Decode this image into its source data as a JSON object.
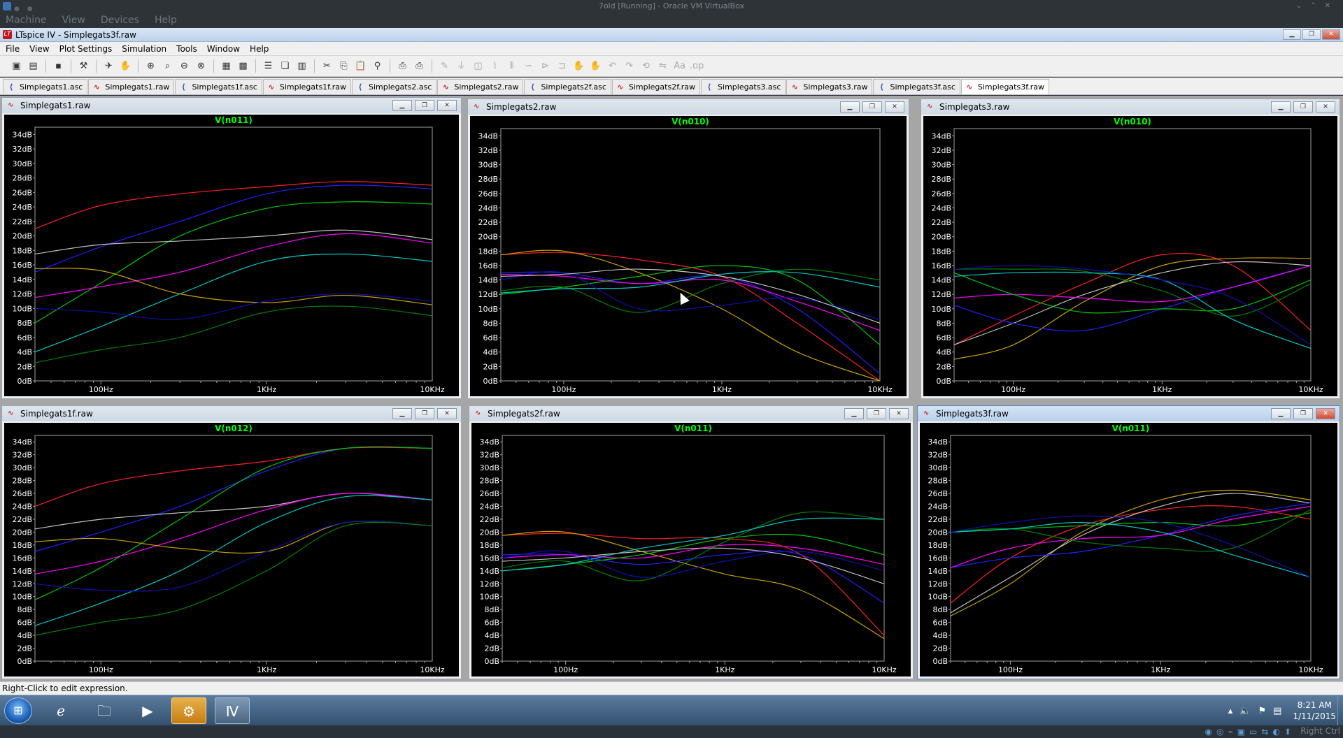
{
  "vbox": {
    "title": "7old [Running] - Oracle VM VirtualBox",
    "menu": [
      "Machine",
      "View",
      "Devices",
      "Help"
    ],
    "host_key": "Right Ctrl"
  },
  "app": {
    "title": "LTspice IV - Simplegats3f.raw",
    "menu": [
      "File",
      "View",
      "Plot Settings",
      "Simulation",
      "Tools",
      "Window",
      "Help"
    ],
    "status": "Right-Click to edit expression."
  },
  "tabs": [
    {
      "label": "Simplegats1.asc",
      "kind": "schematic"
    },
    {
      "label": "Simplegats1.raw",
      "kind": "waveform"
    },
    {
      "label": "Simplegats1f.asc",
      "kind": "schematic"
    },
    {
      "label": "Simplegats1f.raw",
      "kind": "waveform"
    },
    {
      "label": "Simplegats2.asc",
      "kind": "schematic"
    },
    {
      "label": "Simplegats2.raw",
      "kind": "waveform"
    },
    {
      "label": "Simplegats2f.asc",
      "kind": "schematic"
    },
    {
      "label": "Simplegats2f.raw",
      "kind": "waveform"
    },
    {
      "label": "Simplegats3.asc",
      "kind": "schematic"
    },
    {
      "label": "Simplegats3.raw",
      "kind": "waveform"
    },
    {
      "label": "Simplegats3f.asc",
      "kind": "schematic"
    },
    {
      "label": "Simplegats3f.raw",
      "kind": "waveform",
      "active": true
    }
  ],
  "colors": {
    "plot_bg": "#000000",
    "axis": "#a0a0a0",
    "text": "#ffffff",
    "trace_title": "#00ff00",
    "series": [
      "#ff2020",
      "#2020ff",
      "#00c800",
      "#ff00ff",
      "#00c8c8",
      "#c8a000",
      "#c0c0c0",
      "#1010b0",
      "#008000"
    ]
  },
  "chart_data": [
    {
      "window_title": "Simplegats1.raw",
      "type": "line",
      "title": "V(n011)",
      "x_scale": "log",
      "xlim": [
        40,
        10000
      ],
      "ylim": [
        0,
        35
      ],
      "yticks": [
        "0dB",
        "2dB",
        "4dB",
        "6dB",
        "8dB",
        "10dB",
        "12dB",
        "14dB",
        "16dB",
        "18dB",
        "20dB",
        "22dB",
        "24dB",
        "26dB",
        "28dB",
        "30dB",
        "32dB",
        "34dB"
      ],
      "xticks": [
        {
          "v": 100,
          "label": "100Hz"
        },
        {
          "v": 1000,
          "label": "1KHz"
        },
        {
          "v": 10000,
          "label": "10KHz"
        }
      ],
      "x": [
        40,
        100,
        300,
        1000,
        3000,
        10000
      ],
      "series": [
        {
          "color": "#ff2020",
          "values": [
            21,
            24.2,
            25.8,
            26.8,
            27.5,
            27
          ]
        },
        {
          "color": "#2020ff",
          "values": [
            15,
            18.5,
            22,
            25.8,
            27,
            26.5
          ]
        },
        {
          "color": "#00c800",
          "values": [
            8,
            13.5,
            20,
            23.8,
            24.7,
            24.4
          ]
        },
        {
          "color": "#c0c0c0",
          "values": [
            17.5,
            18.8,
            19.3,
            20,
            20.8,
            19.5
          ]
        },
        {
          "color": "#ff00ff",
          "values": [
            11.5,
            13,
            15,
            18.5,
            20.3,
            19
          ]
        },
        {
          "color": "#00c8c8",
          "values": [
            4,
            7.5,
            12,
            16.5,
            17.5,
            16.5
          ]
        },
        {
          "color": "#c8a000",
          "values": [
            15.5,
            15.2,
            12,
            10.8,
            11.8,
            10.5
          ]
        },
        {
          "color": "#1010b0",
          "values": [
            10,
            9.5,
            8.5,
            11,
            12,
            11
          ]
        },
        {
          "color": "#008000",
          "values": [
            2.5,
            4.3,
            6,
            9.5,
            10.3,
            9
          ]
        }
      ]
    },
    {
      "window_title": "Simplegats2.raw",
      "type": "line",
      "title": "V(n010)",
      "x_scale": "log",
      "xlim": [
        40,
        10000
      ],
      "ylim": [
        0,
        35
      ],
      "yticks": [
        "0dB",
        "2dB",
        "4dB",
        "6dB",
        "8dB",
        "10dB",
        "12dB",
        "14dB",
        "16dB",
        "18dB",
        "20dB",
        "22dB",
        "24dB",
        "26dB",
        "28dB",
        "30dB",
        "32dB",
        "34dB"
      ],
      "xticks": [
        {
          "v": 100,
          "label": "100Hz"
        },
        {
          "v": 1000,
          "label": "1KHz"
        },
        {
          "v": 10000,
          "label": "10KHz"
        }
      ],
      "x": [
        40,
        100,
        300,
        1000,
        3000,
        10000
      ],
      "series": [
        {
          "color": "#ff2020",
          "values": [
            17.5,
            17.8,
            16.8,
            14.5,
            8,
            0
          ]
        },
        {
          "color": "#c8a000",
          "values": [
            17.5,
            18,
            15,
            10,
            4,
            0
          ]
        },
        {
          "color": "#2020ff",
          "values": [
            15,
            15,
            13.5,
            14.5,
            10,
            1
          ]
        },
        {
          "color": "#ff00ff",
          "values": [
            14.8,
            14.5,
            13.5,
            14,
            11,
            7
          ]
        },
        {
          "color": "#00c800",
          "values": [
            12,
            13,
            14.5,
            16,
            14,
            5
          ]
        },
        {
          "color": "#008000",
          "values": [
            12.5,
            13,
            9.5,
            13.5,
            15.5,
            14
          ]
        },
        {
          "color": "#00c8c8",
          "values": [
            12.2,
            12.8,
            13,
            14.8,
            15,
            13
          ]
        },
        {
          "color": "#1010b0",
          "values": [
            14,
            15,
            10,
            10.5,
            11.5,
            8.5
          ]
        },
        {
          "color": "#c0c0c0",
          "values": [
            14.5,
            14.8,
            15.5,
            14.5,
            12,
            8
          ]
        }
      ]
    },
    {
      "window_title": "Simplegats3.raw",
      "type": "line",
      "title": "V(n010)",
      "x_scale": "log",
      "xlim": [
        40,
        10000
      ],
      "ylim": [
        0,
        35
      ],
      "yticks": [
        "0dB",
        "2dB",
        "4dB",
        "6dB",
        "8dB",
        "10dB",
        "12dB",
        "14dB",
        "16dB",
        "18dB",
        "20dB",
        "22dB",
        "24dB",
        "26dB",
        "28dB",
        "30dB",
        "32dB",
        "34dB"
      ],
      "xticks": [
        {
          "v": 100,
          "label": "100Hz"
        },
        {
          "v": 1000,
          "label": "1KHz"
        },
        {
          "v": 10000,
          "label": "10KHz"
        }
      ],
      "x": [
        40,
        100,
        300,
        1000,
        3000,
        10000
      ],
      "series": [
        {
          "color": "#ff2020",
          "values": [
            5,
            9,
            13.5,
            17.5,
            16,
            7
          ]
        },
        {
          "color": "#c8a000",
          "values": [
            3,
            5,
            11,
            16,
            17,
            17
          ]
        },
        {
          "color": "#c0c0c0",
          "values": [
            5,
            8,
            12,
            15,
            16.5,
            16
          ]
        },
        {
          "color": "#2020ff",
          "values": [
            10.5,
            8,
            7,
            10,
            13,
            16
          ]
        },
        {
          "color": "#ff00ff",
          "values": [
            11.5,
            12,
            11.5,
            11,
            13,
            16
          ]
        },
        {
          "color": "#00c800",
          "values": [
            15,
            12,
            9.5,
            10,
            10,
            14
          ]
        },
        {
          "color": "#008000",
          "values": [
            15.5,
            15.5,
            15.2,
            12.5,
            9,
            13.5
          ]
        },
        {
          "color": "#00c8c8",
          "values": [
            14.5,
            15,
            15,
            14,
            8.5,
            4.5
          ]
        },
        {
          "color": "#1010b0",
          "values": [
            15.5,
            16,
            15.5,
            14,
            11.5,
            5
          ]
        }
      ]
    },
    {
      "window_title": "Simplegats1f.raw",
      "type": "line",
      "title": "V(n012)",
      "x_scale": "log",
      "xlim": [
        40,
        10000
      ],
      "ylim": [
        0,
        35
      ],
      "yticks": [
        "0dB",
        "2dB",
        "4dB",
        "6dB",
        "8dB",
        "10dB",
        "12dB",
        "14dB",
        "16dB",
        "18dB",
        "20dB",
        "22dB",
        "24dB",
        "26dB",
        "28dB",
        "30dB",
        "32dB",
        "34dB"
      ],
      "xticks": [
        {
          "v": 100,
          "label": "100Hz"
        },
        {
          "v": 1000,
          "label": "1KHz"
        },
        {
          "v": 10000,
          "label": "10KHz"
        }
      ],
      "x": [
        40,
        100,
        300,
        1000,
        3000,
        10000
      ],
      "series": [
        {
          "color": "#ff2020",
          "values": [
            24,
            27.5,
            29.5,
            31,
            33,
            33
          ]
        },
        {
          "color": "#2020ff",
          "values": [
            17,
            20,
            24,
            29.5,
            33,
            33
          ]
        },
        {
          "color": "#00c800",
          "values": [
            9.5,
            14.5,
            22,
            30,
            33,
            33
          ]
        },
        {
          "color": "#c0c0c0",
          "values": [
            20.5,
            22,
            23,
            24,
            26,
            25
          ]
        },
        {
          "color": "#ff00ff",
          "values": [
            13.5,
            15.5,
            19,
            23.5,
            26,
            25
          ]
        },
        {
          "color": "#00c8c8",
          "values": [
            5.5,
            9,
            14,
            21.5,
            25.5,
            25
          ]
        },
        {
          "color": "#c8a000",
          "values": [
            18.5,
            19,
            17.5,
            17,
            21.5,
            21
          ]
        },
        {
          "color": "#1010b0",
          "values": [
            12,
            11,
            11.5,
            17,
            21.5,
            21
          ]
        },
        {
          "color": "#008000",
          "values": [
            4,
            6,
            8,
            14,
            21,
            21
          ]
        }
      ]
    },
    {
      "window_title": "Simplegats2f.raw",
      "type": "line",
      "title": "V(n011)",
      "x_scale": "log",
      "xlim": [
        40,
        10000
      ],
      "ylim": [
        0,
        35
      ],
      "yticks": [
        "0dB",
        "2dB",
        "4dB",
        "6dB",
        "8dB",
        "10dB",
        "12dB",
        "14dB",
        "16dB",
        "18dB",
        "20dB",
        "22dB",
        "24dB",
        "26dB",
        "28dB",
        "30dB",
        "32dB",
        "34dB"
      ],
      "xticks": [
        {
          "v": 100,
          "label": "100Hz"
        },
        {
          "v": 1000,
          "label": "1KHz"
        },
        {
          "v": 10000,
          "label": "10KHz"
        }
      ],
      "x": [
        40,
        100,
        300,
        1000,
        3000,
        10000
      ],
      "series": [
        {
          "color": "#ff2020",
          "values": [
            19.5,
            19.8,
            19,
            19,
            16.5,
            4
          ]
        },
        {
          "color": "#c8a000",
          "values": [
            19.5,
            20,
            17,
            13.5,
            11,
            3.5
          ]
        },
        {
          "color": "#2020ff",
          "values": [
            16.5,
            16.5,
            15,
            16.5,
            16.5,
            9
          ]
        },
        {
          "color": "#ff00ff",
          "values": [
            16,
            16.5,
            16,
            18,
            17.5,
            15
          ]
        },
        {
          "color": "#00c800",
          "values": [
            14,
            15,
            16.5,
            19,
            19.5,
            16.5
          ]
        },
        {
          "color": "#008000",
          "values": [
            14.5,
            15.5,
            12.5,
            18.5,
            23,
            22
          ]
        },
        {
          "color": "#00c8c8",
          "values": [
            14,
            15,
            17.5,
            19.5,
            22,
            22
          ]
        },
        {
          "color": "#1010b0",
          "values": [
            16,
            17,
            13,
            15.5,
            17,
            14
          ]
        },
        {
          "color": "#c0c0c0",
          "values": [
            15.5,
            16,
            17,
            17.5,
            16,
            12
          ]
        }
      ]
    },
    {
      "window_title": "Simplegats3f.raw",
      "type": "line",
      "title": "V(n011)",
      "x_scale": "log",
      "xlim": [
        40,
        10000
      ],
      "ylim": [
        0,
        35
      ],
      "yticks": [
        "0dB",
        "2dB",
        "4dB",
        "6dB",
        "8dB",
        "10dB",
        "12dB",
        "14dB",
        "16dB",
        "18dB",
        "20dB",
        "22dB",
        "24dB",
        "26dB",
        "28dB",
        "30dB",
        "32dB",
        "34dB"
      ],
      "xticks": [
        {
          "v": 100,
          "label": "100Hz"
        },
        {
          "v": 1000,
          "label": "1KHz"
        },
        {
          "v": 10000,
          "label": "10KHz"
        }
      ],
      "x": [
        40,
        100,
        300,
        1000,
        3000,
        10000
      ],
      "series": [
        {
          "color": "#ff2020",
          "values": [
            9,
            16,
            21,
            23.5,
            24,
            22
          ]
        },
        {
          "color": "#c8a000",
          "values": [
            7,
            12,
            20,
            25,
            26.5,
            25
          ]
        },
        {
          "color": "#c0c0c0",
          "values": [
            7.5,
            13,
            19.5,
            24,
            26,
            24.5
          ]
        },
        {
          "color": "#2020ff",
          "values": [
            14.5,
            16,
            17,
            19.5,
            22.5,
            24.5
          ]
        },
        {
          "color": "#ff00ff",
          "values": [
            14.5,
            17.5,
            19,
            19.5,
            22,
            24
          ]
        },
        {
          "color": "#00c800",
          "values": [
            20,
            20.5,
            21,
            21.5,
            21,
            23
          ]
        },
        {
          "color": "#008000",
          "values": [
            20,
            20.5,
            18.5,
            17.5,
            17.5,
            23.5
          ]
        },
        {
          "color": "#00c8c8",
          "values": [
            20,
            20.5,
            21.5,
            20,
            16.5,
            13
          ]
        },
        {
          "color": "#1010b0",
          "values": [
            20,
            21.5,
            22.5,
            21.5,
            18,
            13
          ]
        }
      ]
    }
  ],
  "taskbar": {
    "apps": [
      {
        "name": "internet-explorer"
      },
      {
        "name": "windows-explorer"
      },
      {
        "name": "media-player"
      },
      {
        "name": "control-panel"
      },
      {
        "name": "ltspice"
      }
    ],
    "time": "8:21 AM",
    "date": "1/11/2015"
  }
}
